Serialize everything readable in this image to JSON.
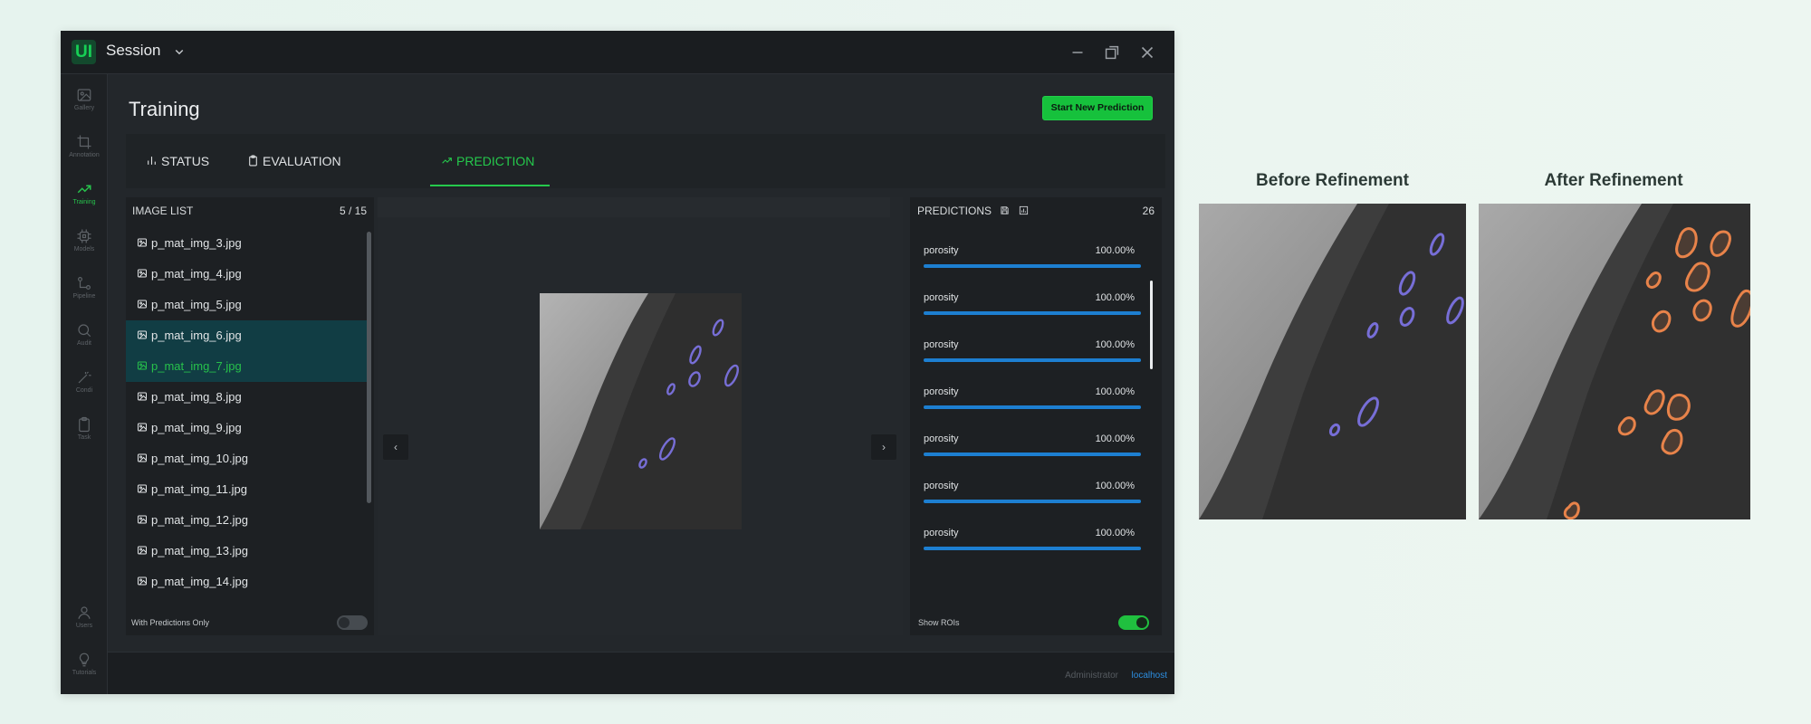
{
  "window": {
    "logo": "UI",
    "session_title": "Session",
    "page_title": "Training",
    "start_button": "Start New Prediction"
  },
  "rail": [
    {
      "label": "Gallery",
      "icon": "image-icon"
    },
    {
      "label": "Annotation",
      "icon": "crop-icon"
    },
    {
      "label": "Training",
      "icon": "trending-up-icon"
    },
    {
      "label": "Models",
      "icon": "chip-icon"
    },
    {
      "label": "Pipeline",
      "icon": "pipeline-icon"
    },
    {
      "label": "Audit",
      "icon": "search-icon"
    },
    {
      "label": "Condi",
      "icon": "wand-icon"
    },
    {
      "label": "Task",
      "icon": "clipboard-icon"
    },
    {
      "label": "Users",
      "icon": "user-icon"
    },
    {
      "label": "Tutorials",
      "icon": "bulb-icon"
    }
  ],
  "tabs": {
    "status": "STATUS",
    "evaluation": "EVALUATION",
    "prediction": "PREDICTION"
  },
  "image_list": {
    "title": "IMAGE LIST",
    "count": "5 / 15",
    "items": [
      "p_mat_img_3.jpg",
      "p_mat_img_4.jpg",
      "p_mat_img_5.jpg",
      "p_mat_img_6.jpg",
      "p_mat_img_7.jpg",
      "p_mat_img_8.jpg",
      "p_mat_img_9.jpg",
      "p_mat_img_10.jpg",
      "p_mat_img_11.jpg",
      "p_mat_img_12.jpg",
      "p_mat_img_13.jpg",
      "p_mat_img_14.jpg"
    ],
    "selected_index": 4,
    "filter_label": "With Predictions Only",
    "filter_on": false
  },
  "predictions": {
    "title": "PREDICTIONS",
    "count": "26",
    "items": [
      {
        "label": "porosity",
        "score": "100.00%",
        "fill": 1.0
      },
      {
        "label": "porosity",
        "score": "100.00%",
        "fill": 1.0
      },
      {
        "label": "porosity",
        "score": "100.00%",
        "fill": 1.0
      },
      {
        "label": "porosity",
        "score": "100.00%",
        "fill": 1.0
      },
      {
        "label": "porosity",
        "score": "100.00%",
        "fill": 1.0
      },
      {
        "label": "porosity",
        "score": "100.00%",
        "fill": 1.0
      },
      {
        "label": "porosity",
        "score": "100.00%",
        "fill": 1.0
      }
    ],
    "show_rois_label": "Show ROIs",
    "show_rois_on": true
  },
  "statusbar": {
    "user": "Administrator",
    "host": "localhost"
  },
  "comparison": {
    "before_title": "Before Refinement",
    "after_title": "After Refinement"
  },
  "colors": {
    "accent": "#25c94c",
    "bar": "#1d7fd1",
    "roi_before": "#7b72e0",
    "roi_after": "#e8834a"
  }
}
